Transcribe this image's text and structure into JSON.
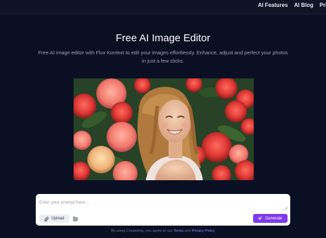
{
  "nav": {
    "items": [
      {
        "label": "AI Features"
      },
      {
        "label": "AI Blog"
      },
      {
        "label": "Pricing"
      }
    ]
  },
  "hero": {
    "title": "Free AI Image Editor",
    "subtitle": "Free AI image editor with Flux Kontext to edit your images effortlessly. Enhance, adjust and perfect your photos in just a few clicks."
  },
  "prompt": {
    "placeholder": "Enter your prompt here...",
    "value": "",
    "upload_label": "Upload",
    "generate_label": "Generate"
  },
  "footer": {
    "prefix": "By using Createimg, you agree to our",
    "terms": "Terms",
    "and": "and",
    "privacy": "Privacy Policy"
  },
  "icons": {
    "upload": "paperclip-icon",
    "settings": "sliders-icon",
    "generate": "sparkle-icon"
  },
  "colors": {
    "background": "#0b0f24",
    "accent": "#7c3aed",
    "link": "#7c8cff"
  }
}
